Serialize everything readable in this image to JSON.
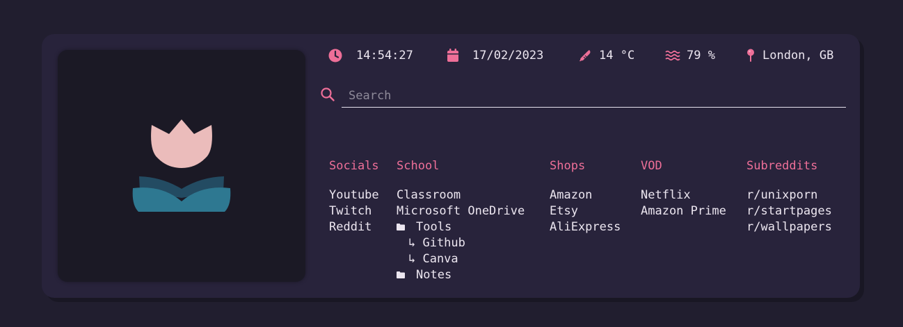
{
  "status": {
    "time": "14:54:27",
    "date": "17/02/2023",
    "temperature": "14 °C",
    "humidity": "79 %",
    "location": "London, GB"
  },
  "search": {
    "placeholder": "Search",
    "value": ""
  },
  "columns": [
    {
      "title": "Socials",
      "links": [
        "Youtube",
        "Twitch",
        "Reddit"
      ]
    },
    {
      "title": "School",
      "links": [
        "Classroom",
        "Microsoft OneDrive"
      ],
      "folders": [
        {
          "label": "Tools",
          "items": [
            "↳ Github",
            "↳ Canva"
          ]
        },
        {
          "label": "Notes",
          "items": []
        }
      ]
    },
    {
      "title": "Shops",
      "links": [
        "Amazon",
        "Etsy",
        "AliExpress"
      ]
    },
    {
      "title": "VOD",
      "links": [
        "Netflix",
        "Amazon Prime"
      ]
    },
    {
      "title": "Subreddits",
      "links": [
        "r/unixporn",
        "r/startpages",
        "r/wallpapers"
      ]
    }
  ],
  "colors": {
    "background": "#211e2f",
    "card": "#28233b",
    "accent": "#ee6f98",
    "text": "#ece6f0",
    "tulip_petal": "#ebbcbb",
    "tulip_leaf": "#2e7891"
  },
  "icons": {
    "time": "clock-icon",
    "date": "calendar-icon",
    "temperature": "thermometer-icon",
    "humidity": "humidity-waves-icon",
    "location": "map-pin-icon",
    "search": "search-icon",
    "folder": "folder-icon",
    "image": "tulip-illustration"
  }
}
